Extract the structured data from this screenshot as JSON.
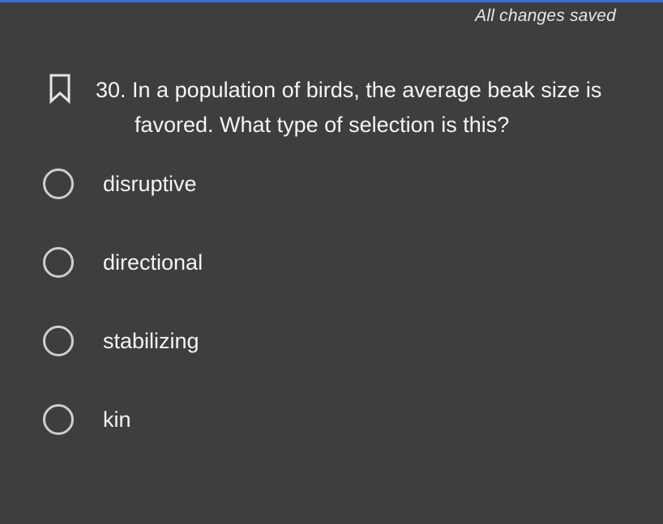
{
  "header": {
    "save_status": "All changes saved",
    "accent_color": "#3b6fd1"
  },
  "question": {
    "bookmark_icon": "bookmark-outline-icon",
    "line1": "30. In a population of birds, the average beak size is",
    "line2": "favored. What type of selection is this?"
  },
  "options": [
    {
      "label": "disruptive",
      "selected": false
    },
    {
      "label": "directional",
      "selected": false
    },
    {
      "label": "stabilizing",
      "selected": false
    },
    {
      "label": "kin",
      "selected": false
    }
  ]
}
